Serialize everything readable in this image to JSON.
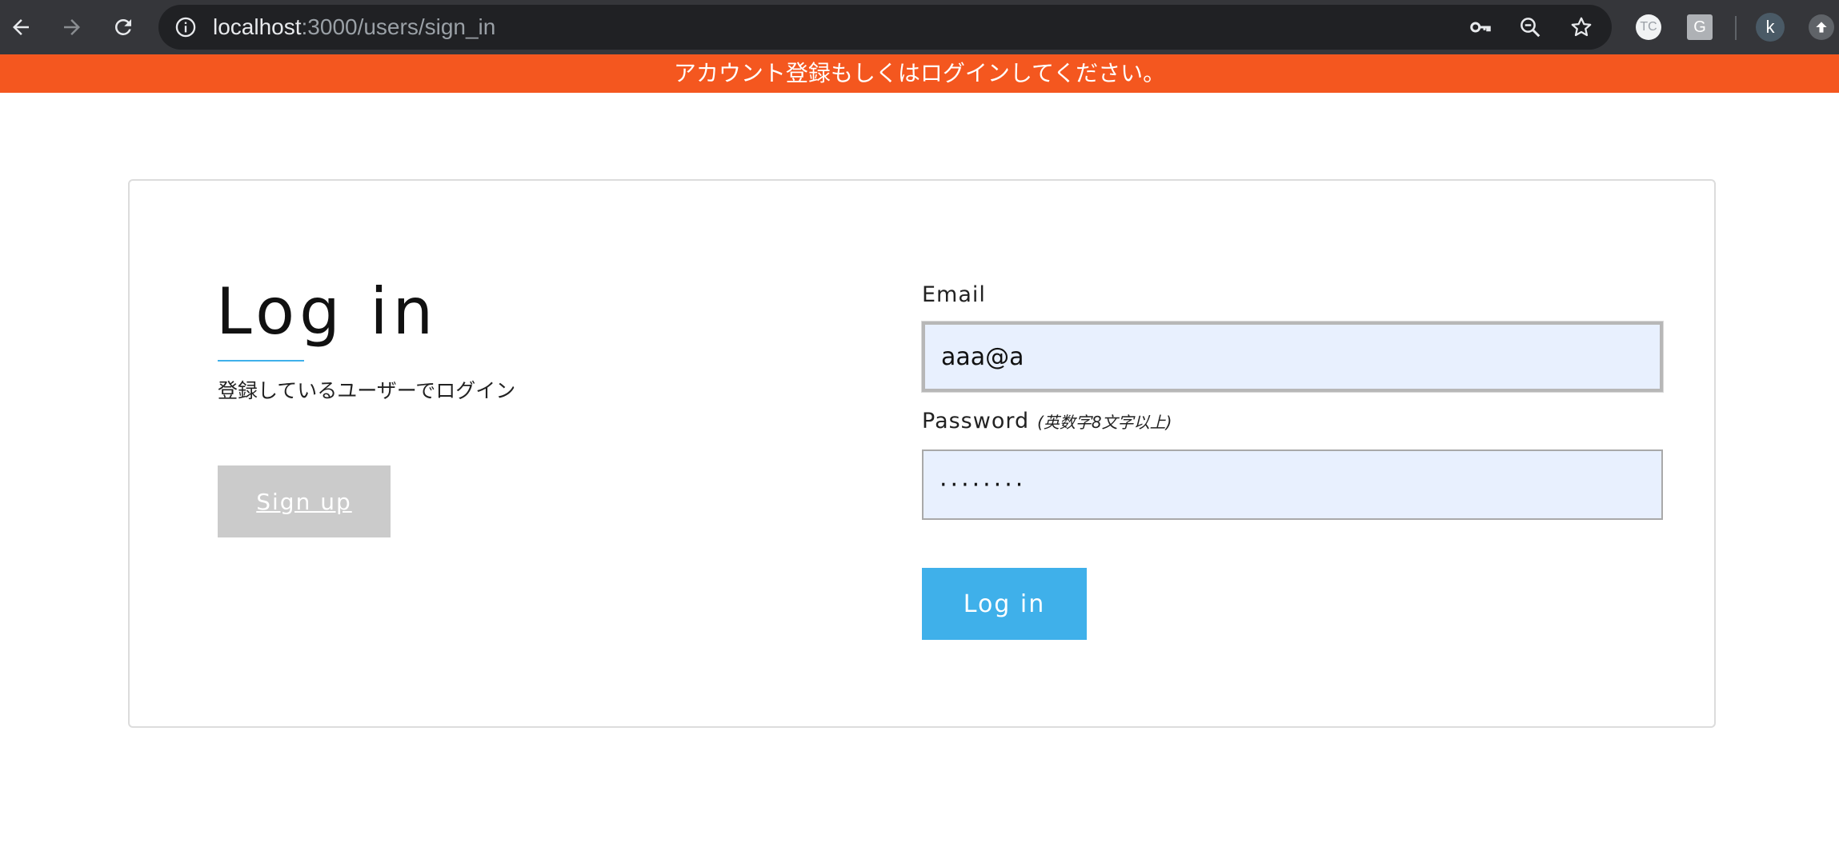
{
  "browser": {
    "url_host": "localhost",
    "url_path": ":3000/users/sign_in",
    "extensions": {
      "tc_label": "TC",
      "g_label": "G"
    },
    "profile_initial": "k",
    "icons": [
      "back-arrow-icon",
      "forward-arrow-icon",
      "reload-icon",
      "info-icon",
      "key-icon",
      "zoom-out-icon",
      "star-icon",
      "update-icon"
    ]
  },
  "flash": {
    "message": "アカウント登録もしくはログインしてください。"
  },
  "login": {
    "title": "Log in",
    "subtitle": "登録しているユーザーでログイン",
    "signup_label": "Sign up",
    "email_label": "Email",
    "email_value": "aaa@a",
    "password_label": "Password",
    "password_hint": "(英数字8文字以上)",
    "password_value": "········",
    "submit_label": "Log in"
  },
  "colors": {
    "flash_bg": "#f4571f",
    "accent": "#3fb0ea",
    "signup_bg": "#cbcbcb",
    "input_bg": "#e8f0fe",
    "toolbar_bg": "#35363a"
  }
}
